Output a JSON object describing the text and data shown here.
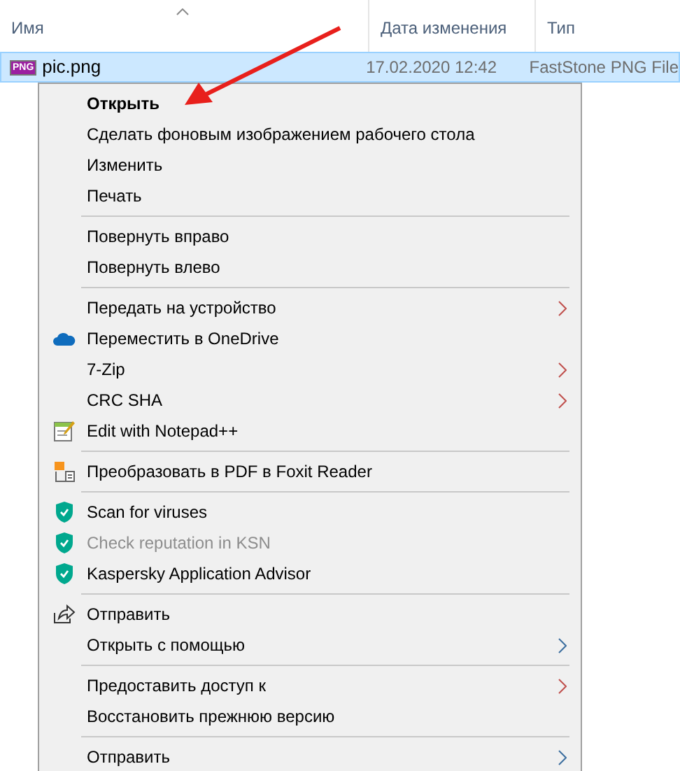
{
  "columns": [
    {
      "label": "Имя",
      "sorted": true
    },
    {
      "label": "Дата изменения",
      "sorted": false
    },
    {
      "label": "Тип",
      "sorted": false
    }
  ],
  "file": {
    "icon_label": "PNG",
    "name": "pic.png",
    "date": "17.02.2020 12:42",
    "type": "FastStone PNG File",
    "selected": true
  },
  "menu": [
    {
      "kind": "item",
      "label": "Открыть",
      "default": true,
      "disabled": false,
      "submenu": false
    },
    {
      "kind": "item",
      "label": "Сделать фоновым изображением рабочего стола",
      "default": false,
      "disabled": false,
      "submenu": false
    },
    {
      "kind": "item",
      "label": "Изменить",
      "default": false,
      "disabled": false,
      "submenu": false
    },
    {
      "kind": "item",
      "label": "Печать",
      "default": false,
      "disabled": false,
      "submenu": false
    },
    {
      "kind": "separator"
    },
    {
      "kind": "item",
      "label": "Повернуть вправо",
      "default": false,
      "disabled": false,
      "submenu": false
    },
    {
      "kind": "item",
      "label": "Повернуть влево",
      "default": false,
      "disabled": false,
      "submenu": false
    },
    {
      "kind": "separator"
    },
    {
      "kind": "item",
      "label": "Передать на устройство",
      "default": false,
      "disabled": false,
      "submenu": true,
      "color": "#c0504d"
    },
    {
      "kind": "item",
      "label": "Переместить в OneDrive",
      "default": false,
      "disabled": false,
      "submenu": false
    },
    {
      "kind": "item",
      "label": "7-Zip",
      "default": false,
      "disabled": false,
      "submenu": true,
      "color": "#c0504d"
    },
    {
      "kind": "item",
      "label": "CRC SHA",
      "default": false,
      "disabled": false,
      "submenu": true,
      "color": "#c0504d"
    },
    {
      "kind": "item",
      "label": "Edit with Notepad++",
      "default": false,
      "disabled": false,
      "submenu": false
    },
    {
      "kind": "separator"
    },
    {
      "kind": "item",
      "label": "Преобразовать в PDF в Foxit Reader",
      "default": false,
      "disabled": false,
      "submenu": false
    },
    {
      "kind": "separator"
    },
    {
      "kind": "item",
      "label": "Scan for viruses",
      "default": false,
      "disabled": false,
      "submenu": false
    },
    {
      "kind": "item",
      "label": "Check reputation in KSN",
      "default": false,
      "disabled": true,
      "submenu": false
    },
    {
      "kind": "item",
      "label": "Kaspersky Application Advisor",
      "default": false,
      "disabled": false,
      "submenu": false
    },
    {
      "kind": "separator"
    },
    {
      "kind": "item",
      "label": "Отправить",
      "default": false,
      "disabled": false,
      "submenu": false
    },
    {
      "kind": "item",
      "label": "Открыть с помощью",
      "default": false,
      "disabled": false,
      "submenu": true,
      "color": "#3c6e9f"
    },
    {
      "kind": "separator"
    },
    {
      "kind": "item",
      "label": "Предоставить доступ к",
      "default": false,
      "disabled": false,
      "submenu": true,
      "color": "#c0504d"
    },
    {
      "kind": "item",
      "label": "Восстановить прежнюю версию",
      "default": false,
      "disabled": false,
      "submenu": false
    },
    {
      "kind": "separator"
    },
    {
      "kind": "item",
      "label": "Отправить",
      "default": false,
      "disabled": false,
      "submenu": true,
      "color": "#3c6e9f"
    }
  ]
}
